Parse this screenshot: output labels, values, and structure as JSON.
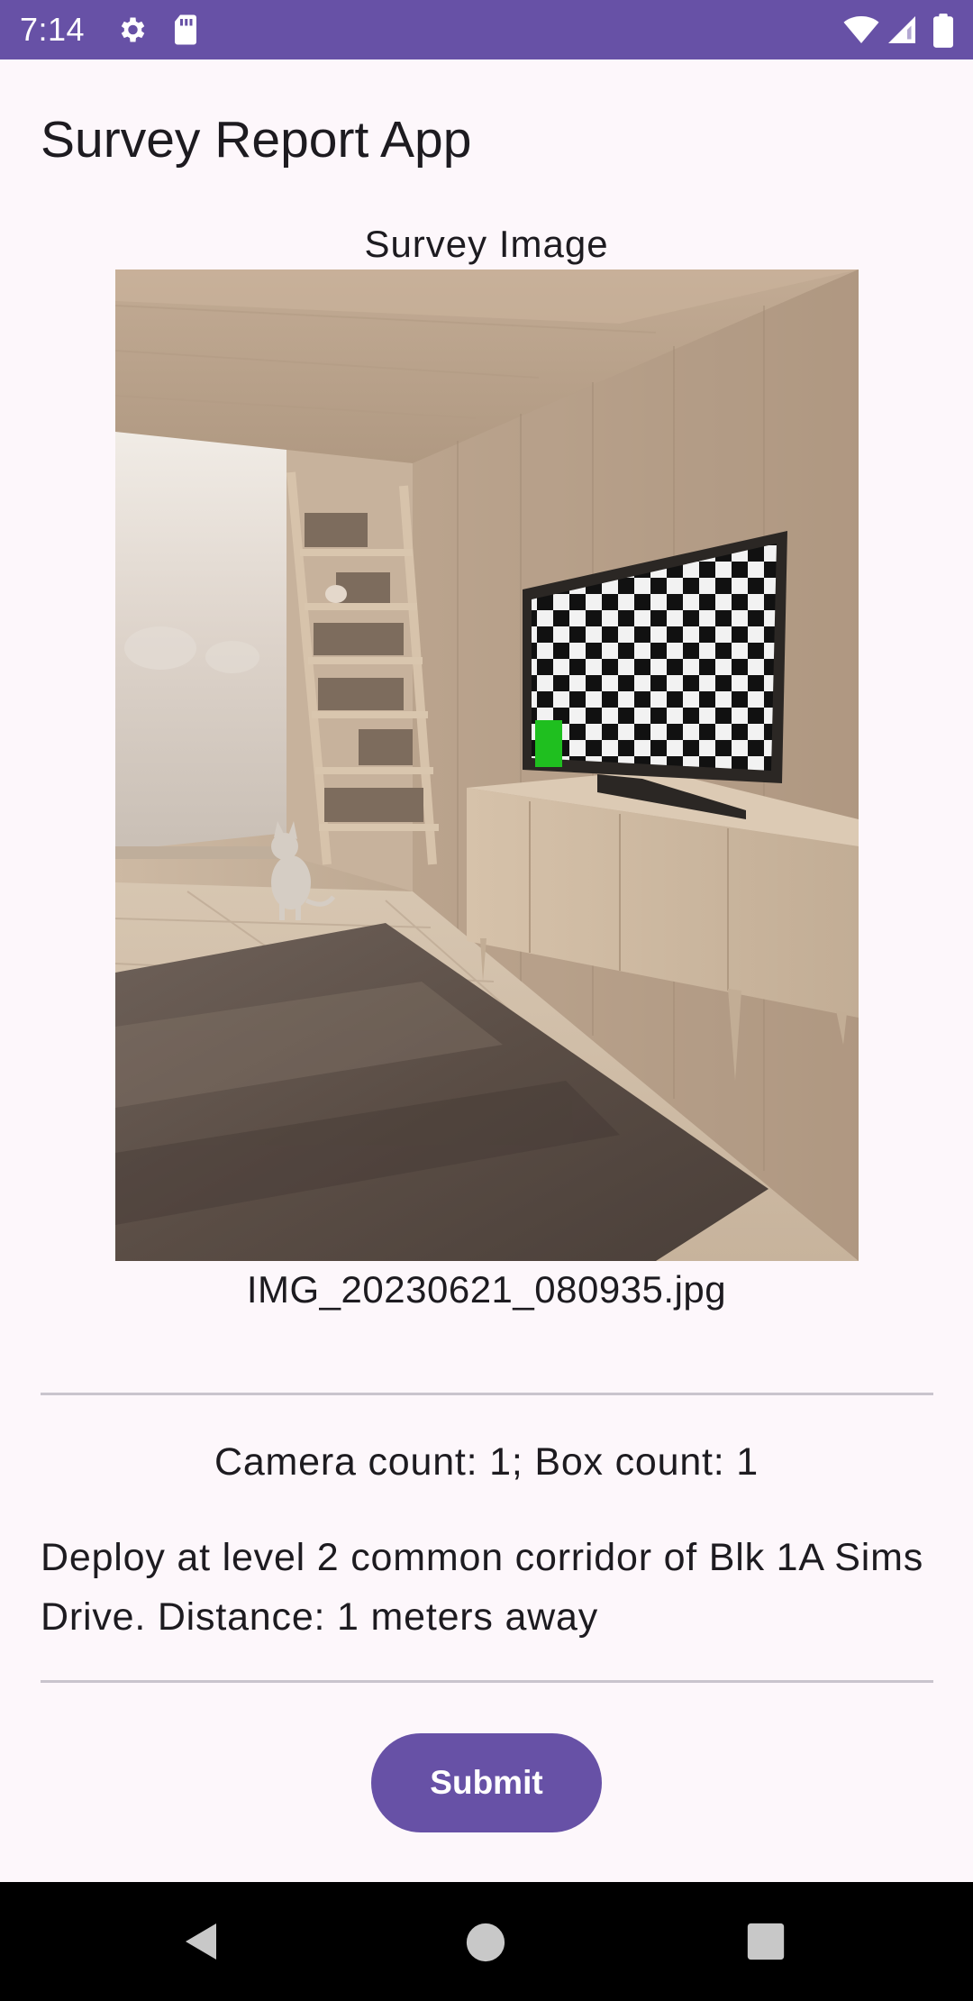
{
  "status_bar": {
    "time": "7:14",
    "left_icons": [
      "settings-gear-icon",
      "sd-card-icon"
    ],
    "right_icons": [
      "wifi-icon",
      "signal-icon",
      "battery-icon"
    ],
    "color": "#6751a6"
  },
  "app": {
    "title": "Survey Report App"
  },
  "survey": {
    "image_label": "Survey Image",
    "file_name": "IMG_20230621_080935.jpg",
    "counts": "Camera count: 1; Box count: 1",
    "description": "Deploy at level 2 common corridor of Blk 1A Sims Drive. Distance: 1 meters away"
  },
  "actions": {
    "submit_label": "Submit",
    "accent": "#6751a6"
  },
  "nav_bar": {
    "buttons": [
      "back-icon",
      "home-icon",
      "recents-icon"
    ]
  }
}
